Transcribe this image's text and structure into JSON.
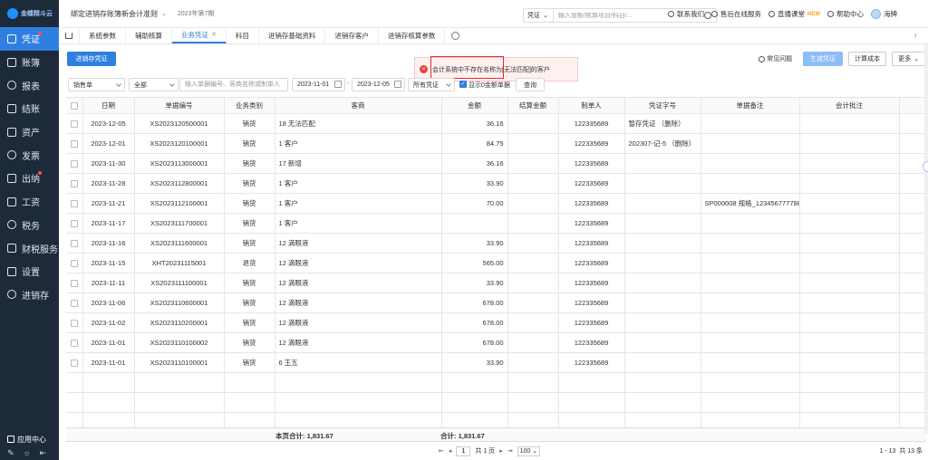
{
  "brand": {
    "logo_text": "金蝶精斗云"
  },
  "sidebar": {
    "items": [
      {
        "label": "凭证",
        "active": true,
        "dot": true
      },
      {
        "label": "账簿"
      },
      {
        "label": "报表"
      },
      {
        "label": "结账"
      },
      {
        "label": "资产"
      },
      {
        "label": "发票"
      },
      {
        "label": "出纳",
        "dot": true
      },
      {
        "label": "工资"
      },
      {
        "label": "税务"
      },
      {
        "label": "财税服务"
      },
      {
        "label": "设置"
      },
      {
        "label": "进销存"
      }
    ],
    "app_center": "应用中心"
  },
  "topbar": {
    "account_title": "绑定进销存账簿新会计准则",
    "period": "2023年第7期",
    "search_type": "凭证",
    "search_placeholder": "输入金额/核算项目/科目/...",
    "links": [
      "联系我们",
      "售后在线服务",
      "直播课堂",
      "帮助中心",
      "海牌"
    ],
    "new_badge": "NEW"
  },
  "tabs": [
    {
      "label": "系统参数"
    },
    {
      "label": "辅助核算"
    },
    {
      "label": "业务凭证",
      "active": true,
      "closable": true
    },
    {
      "label": "科目"
    },
    {
      "label": "进销存基础资料"
    },
    {
      "label": "进销存客户"
    },
    {
      "label": "进销存核算参数"
    }
  ],
  "actions": {
    "primary": "进销存凭证",
    "faq": "常见问题",
    "generate": "生成凭证",
    "calc_cost": "计算成本",
    "more": "更多"
  },
  "toast": {
    "message": "会计系统中不存在名称为[无法匹配]的客户"
  },
  "filters": {
    "doc_type": "销售单",
    "scope": "全部",
    "keyword_placeholder": "输入单据编号、客商名称或制单人",
    "date_from": "2023-11-01",
    "date_to": "2023-12-05",
    "voucher_state": "所有凭证",
    "show_zero_label": "显示0金额单据",
    "query": "查询"
  },
  "table": {
    "columns": [
      "日期",
      "单据编号",
      "业务类别",
      "客商",
      "金额",
      "结算金额",
      "制单人",
      "凭证字号",
      "单据备注",
      "会计批注"
    ],
    "rows": [
      {
        "date": "2023-12-05",
        "no": "XS2023120500001",
        "biz": "销货",
        "party": "18 无法匹配",
        "amount": "36.16",
        "settle": "",
        "maker": "122335689",
        "voucher": "暂存凭证 （删除）",
        "note": "",
        "remark": ""
      },
      {
        "date": "2023-12-01",
        "no": "XS2023120100001",
        "biz": "销货",
        "party": "1 客户",
        "amount": "84.75",
        "settle": "",
        "maker": "122335689",
        "voucher": "202307-记-5 （删除）",
        "note": "",
        "remark": ""
      },
      {
        "date": "2023-11-30",
        "no": "XS2023113000001",
        "biz": "销货",
        "party": "17 新增",
        "amount": "36.16",
        "settle": "",
        "maker": "122335689",
        "voucher": "",
        "note": "",
        "remark": ""
      },
      {
        "date": "2023-11-28",
        "no": "XS2023112800001",
        "biz": "销货",
        "party": "1 客户",
        "amount": "33.90",
        "settle": "",
        "maker": "122335689",
        "voucher": "",
        "note": "",
        "remark": ""
      },
      {
        "date": "2023-11-21",
        "no": "XS2023112100001",
        "biz": "销货",
        "party": "1 客户",
        "amount": "70.00",
        "settle": "",
        "maker": "122335689",
        "voucher": "",
        "note": "SP000008 规格_123456777788",
        "remark": ""
      },
      {
        "date": "2023-11-17",
        "no": "XS2023111700001",
        "biz": "销货",
        "party": "1 客户",
        "amount": "",
        "settle": "",
        "maker": "122335689",
        "voucher": "",
        "note": "",
        "remark": ""
      },
      {
        "date": "2023-11-16",
        "no": "XS2023111600001",
        "biz": "销货",
        "party": "12 滴眼液",
        "amount": "33.90",
        "settle": "",
        "maker": "122335689",
        "voucher": "",
        "note": "",
        "remark": ""
      },
      {
        "date": "2023-11-15",
        "no": "XHT20231115001",
        "biz": "退货",
        "party": "12 滴眼液",
        "amount": "565.00",
        "settle": "",
        "maker": "122335689",
        "voucher": "",
        "note": "",
        "remark": ""
      },
      {
        "date": "2023-11-11",
        "no": "XS2023111100001",
        "biz": "销货",
        "party": "12 滴眼液",
        "amount": "33.90",
        "settle": "",
        "maker": "122335689",
        "voucher": "",
        "note": "",
        "remark": ""
      },
      {
        "date": "2023-11-06",
        "no": "XS2023110600001",
        "biz": "销货",
        "party": "12 滴眼液",
        "amount": "678.00",
        "settle": "",
        "maker": "122335689",
        "voucher": "",
        "note": "",
        "remark": ""
      },
      {
        "date": "2023-11-02",
        "no": "XS2023110200001",
        "biz": "销货",
        "party": "12 滴眼液",
        "amount": "678.00",
        "settle": "",
        "maker": "122335689",
        "voucher": "",
        "note": "",
        "remark": ""
      },
      {
        "date": "2023-11-01",
        "no": "XS2023110100002",
        "biz": "销货",
        "party": "12 滴眼液",
        "amount": "678.00",
        "settle": "",
        "maker": "122335689",
        "voucher": "",
        "note": "",
        "remark": ""
      },
      {
        "date": "2023-11-01",
        "no": "XS2023110100001",
        "biz": "销货",
        "party": "6 王五",
        "amount": "33.90",
        "settle": "",
        "maker": "122335689",
        "voucher": "",
        "note": "",
        "remark": ""
      }
    ]
  },
  "summary": {
    "page_total": "本页合计: 1,831.67",
    "grand_total": "合计: 1,831.67"
  },
  "pager": {
    "page": "1",
    "of_pages": "共 1 页",
    "page_size": "100",
    "range": "1 - 13",
    "total": "共 13 条"
  },
  "colors": {
    "accent": "#2f7fe0",
    "sidebar_bg": "#1d2a3a",
    "error": "#f23c3c"
  }
}
